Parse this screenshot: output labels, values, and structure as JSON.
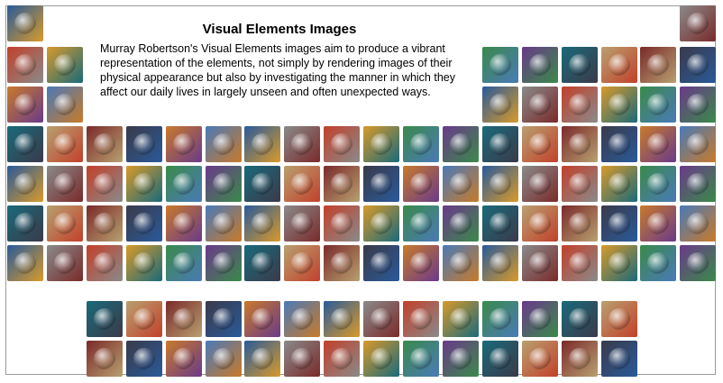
{
  "title": "Visual Elements Images",
  "description": "Murray Robertson's Visual Elements images aim to produce a vibrant representation of the elements, not simply by rendering images of their physical appearance but also by investigating the manner in which they affect our daily lives in largely unseen and often unexpected ways.",
  "palette": [
    "#2a5a9a",
    "#8a8a8a",
    "#c2402a",
    "#d89a2a",
    "#3a8a4a",
    "#6a3a8a",
    "#1a6a7a",
    "#b8a070",
    "#7a2a2a",
    "#3a3a4a",
    "#c87a2a",
    "#4a7ab8"
  ]
}
